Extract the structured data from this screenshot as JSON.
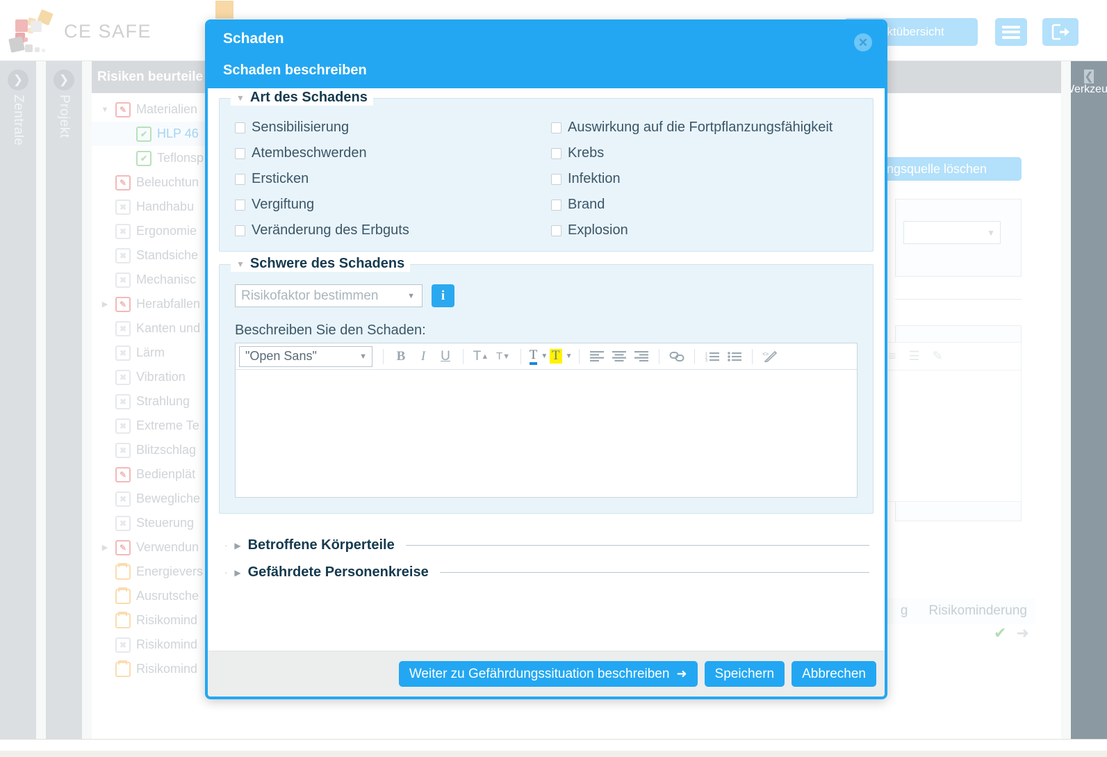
{
  "app": {
    "logo_text": "CE SAFE"
  },
  "topbar": {
    "projektuebersicht_label": "jektübersicht",
    "menu_icon": "hamburger-menu-icon",
    "logout_icon": "logout-icon"
  },
  "left_tabs": [
    {
      "label": "Zentrale",
      "icon": "chevron-right-circle-icon"
    },
    {
      "label": "Projekt",
      "icon": "chevron-right-circle-icon"
    }
  ],
  "right_tab": {
    "label": "Werkzeug",
    "icon": "chevron-left-circle-icon"
  },
  "tree": {
    "header": "Risiken beurteile",
    "items": [
      {
        "label": "Materialien",
        "icon": "document-edit-icon",
        "icon_color": "red",
        "twisty": "down",
        "indent": 0,
        "selected": false
      },
      {
        "label": "HLP 46",
        "icon": "document-check-icon",
        "icon_color": "green",
        "twisty": "",
        "indent": 1,
        "selected": true
      },
      {
        "label": "Teflonsp",
        "icon": "document-check-icon",
        "icon_color": "green",
        "twisty": "",
        "indent": 1,
        "selected": false
      },
      {
        "label": "Beleuchtun",
        "icon": "document-edit-icon",
        "icon_color": "red",
        "twisty": "",
        "indent": 0,
        "selected": false
      },
      {
        "label": "Handhabu",
        "icon": "document-x-icon",
        "icon_color": "grey",
        "twisty": "",
        "indent": 0,
        "selected": false
      },
      {
        "label": "Ergonomie",
        "icon": "document-x-icon",
        "icon_color": "grey",
        "twisty": "",
        "indent": 0,
        "selected": false
      },
      {
        "label": "Standsiche",
        "icon": "document-x-icon",
        "icon_color": "grey",
        "twisty": "",
        "indent": 0,
        "selected": false
      },
      {
        "label": "Mechanisc",
        "icon": "document-x-icon",
        "icon_color": "grey",
        "twisty": "",
        "indent": 0,
        "selected": false
      },
      {
        "label": "Herabfallen",
        "icon": "document-edit-icon",
        "icon_color": "red",
        "twisty": "right",
        "indent": 0,
        "selected": false
      },
      {
        "label": "Kanten und",
        "icon": "document-x-icon",
        "icon_color": "grey",
        "twisty": "",
        "indent": 0,
        "selected": false
      },
      {
        "label": "Lärm",
        "icon": "document-x-icon",
        "icon_color": "grey",
        "twisty": "",
        "indent": 0,
        "selected": false
      },
      {
        "label": "Vibration",
        "icon": "document-x-icon",
        "icon_color": "grey",
        "twisty": "",
        "indent": 0,
        "selected": false
      },
      {
        "label": "Strahlung",
        "icon": "document-x-icon",
        "icon_color": "grey",
        "twisty": "",
        "indent": 0,
        "selected": false
      },
      {
        "label": "Extreme Te",
        "icon": "document-x-icon",
        "icon_color": "grey",
        "twisty": "",
        "indent": 0,
        "selected": false
      },
      {
        "label": "Blitzschlag",
        "icon": "document-x-icon",
        "icon_color": "grey",
        "twisty": "",
        "indent": 0,
        "selected": false
      },
      {
        "label": "Bedienplät",
        "icon": "document-edit-icon",
        "icon_color": "red",
        "twisty": "",
        "indent": 0,
        "selected": false
      },
      {
        "label": "Bewegliche",
        "icon": "document-x-icon",
        "icon_color": "grey",
        "twisty": "",
        "indent": 0,
        "selected": false
      },
      {
        "label": "Steuerung",
        "icon": "document-x-icon",
        "icon_color": "grey",
        "twisty": "",
        "indent": 0,
        "selected": false
      },
      {
        "label": "Verwendun",
        "icon": "document-edit-icon",
        "icon_color": "red",
        "twisty": "right",
        "indent": 0,
        "selected": false
      },
      {
        "label": "Energievers",
        "icon": "folder-icon",
        "icon_color": "orange",
        "twisty": "",
        "indent": 0,
        "selected": false
      },
      {
        "label": "Ausrutsche",
        "icon": "folder-icon",
        "icon_color": "orange",
        "twisty": "",
        "indent": 0,
        "selected": false
      },
      {
        "label": "Risikomind",
        "icon": "folder-icon",
        "icon_color": "orange",
        "twisty": "",
        "indent": 0,
        "selected": false
      },
      {
        "label": "Risikomind",
        "icon": "document-x-icon",
        "icon_color": "grey",
        "twisty": "",
        "indent": 0,
        "selected": false
      },
      {
        "label": "Risikomind",
        "icon": "folder-icon",
        "icon_color": "orange",
        "twisty": "",
        "indent": 0,
        "selected": false
      }
    ]
  },
  "background_panel": {
    "delete_button_label": "hrdungsquelle löschen",
    "table_header_partial": "g",
    "table_header_risikominderung": "Risikominderung",
    "row_check_icon": "check-icon",
    "row_arrow_icon": "arrow-right-icon"
  },
  "modal": {
    "title": "Schaden",
    "subtitle": "Schaden beschreiben",
    "close_icon": "close-circle-icon",
    "section_art": {
      "legend": "Art des Schadens",
      "twisty": "caret-down-icon",
      "checkboxes_left": [
        {
          "label": "Sensibilisierung",
          "checked": false
        },
        {
          "label": "Atembeschwerden",
          "checked": false
        },
        {
          "label": "Ersticken",
          "checked": false
        },
        {
          "label": "Vergiftung",
          "checked": false
        },
        {
          "label": "Veränderung des Erbguts",
          "checked": false
        }
      ],
      "checkboxes_right": [
        {
          "label": "Auswirkung auf die Fortpflanzungsfähigkeit",
          "checked": false
        },
        {
          "label": "Krebs",
          "checked": false
        },
        {
          "label": "Infektion",
          "checked": false
        },
        {
          "label": "Brand",
          "checked": false
        },
        {
          "label": "Explosion",
          "checked": false
        }
      ]
    },
    "section_schwere": {
      "legend": "Schwere des Schadens",
      "twisty": "caret-down-icon",
      "risk_select_value": "Risikofaktor bestimmen",
      "info_button_label": "i",
      "describe_label": "Beschreiben Sie den Schaden:",
      "editor": {
        "font_value": "\"Open Sans\"",
        "content": "",
        "toolbar": [
          {
            "name": "bold-icon",
            "glyph": "B"
          },
          {
            "name": "italic-icon",
            "glyph": "I"
          },
          {
            "name": "underline-icon",
            "glyph": "U"
          },
          {
            "name": "superscript-icon",
            "glyph": "T"
          },
          {
            "name": "subscript-icon",
            "glyph": "T"
          },
          {
            "name": "text-color-icon",
            "glyph": "T"
          },
          {
            "name": "highlight-color-icon",
            "glyph": "T"
          },
          {
            "name": "align-left-icon",
            "glyph": "≡"
          },
          {
            "name": "align-center-icon",
            "glyph": "≡"
          },
          {
            "name": "align-right-icon",
            "glyph": "≡"
          },
          {
            "name": "link-icon",
            "glyph": "🔗"
          },
          {
            "name": "ordered-list-icon",
            "glyph": "1."
          },
          {
            "name": "bullet-list-icon",
            "glyph": "•"
          },
          {
            "name": "source-code-icon",
            "glyph": "</>"
          }
        ]
      }
    },
    "collapsed_sections": [
      {
        "label": "Betroffene Körperteile",
        "twisty": "caret-right-icon"
      },
      {
        "label": "Gefährdete Personenkreise",
        "twisty": "caret-right-icon"
      }
    ],
    "footer": {
      "next_label": "Weiter zu Gefährdungssituation beschreiben",
      "next_arrow": "arrow-right-icon",
      "save_label": "Speichern",
      "cancel_label": "Abbrechen"
    }
  },
  "colors": {
    "accent": "#23a7f2",
    "accent_light": "#b3e0fb",
    "section_bg": "#e9f4fa",
    "heading": "#163a4f",
    "footer_bg": "#eceded"
  }
}
